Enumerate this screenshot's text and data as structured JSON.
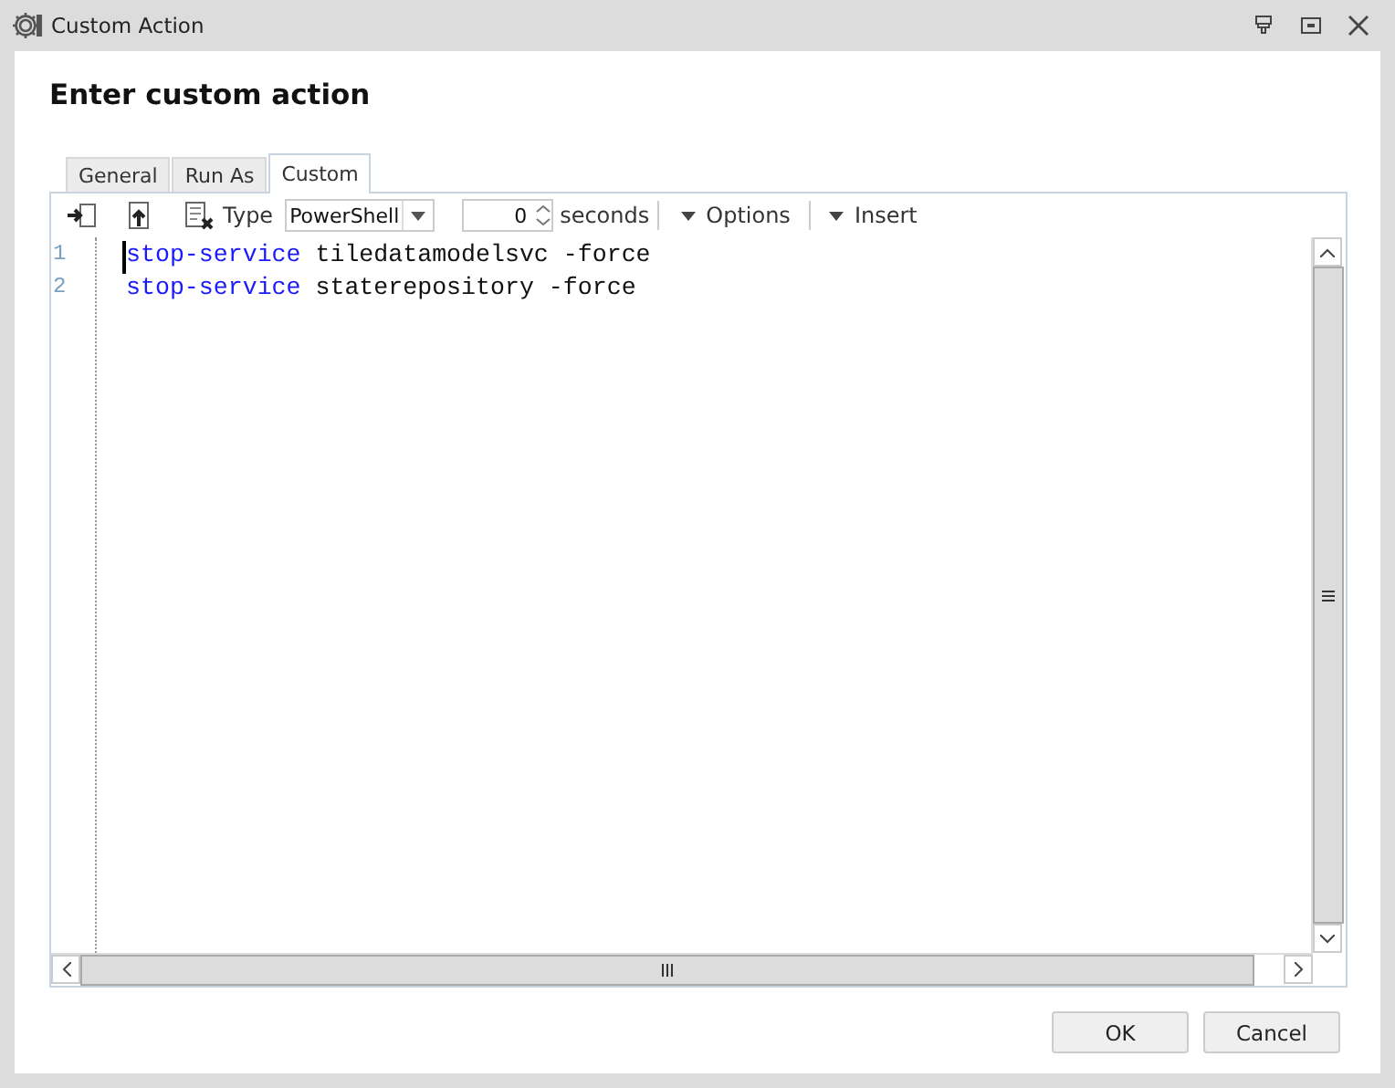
{
  "window": {
    "title": "Custom Action"
  },
  "heading": "Enter custom action",
  "tabs": [
    {
      "label": "General",
      "selected": false
    },
    {
      "label": "Run As",
      "selected": false
    },
    {
      "label": "Custom",
      "selected": true
    }
  ],
  "toolbar": {
    "type_label": "Type",
    "type_value": "PowerShell",
    "seconds_value": "0",
    "seconds_label": "seconds",
    "options_label": "Options",
    "insert_label": "Insert"
  },
  "editor": {
    "lines": [
      {
        "number": "1",
        "tokens": [
          {
            "text": "stop-service",
            "kind": "keyword"
          },
          {
            "text": " tiledatamodelsvc -force",
            "kind": "plain"
          }
        ]
      },
      {
        "number": "2",
        "tokens": [
          {
            "text": "stop-service",
            "kind": "keyword"
          },
          {
            "text": " staterepository -force",
            "kind": "plain"
          }
        ]
      }
    ]
  },
  "buttons": [
    "OK",
    "Cancel"
  ]
}
